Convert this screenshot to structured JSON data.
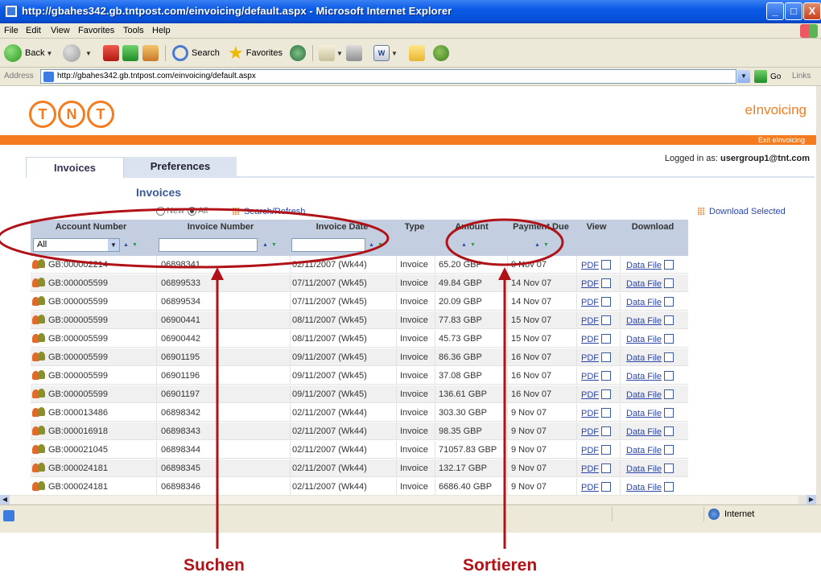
{
  "window": {
    "title": "http://gbahes342.gb.tntpost.com/einvoicing/default.aspx - Microsoft Internet Explorer",
    "controls": [
      "_",
      "□",
      "X"
    ]
  },
  "menu": [
    "File",
    "Edit",
    "View",
    "Favorites",
    "Tools",
    "Help"
  ],
  "toolbar": {
    "back": "Back",
    "search": "Search",
    "favorites": "Favorites"
  },
  "address": {
    "label": "Address",
    "url": "http://gbahes342.gb.tntpost.com/einvoicing/default.aspx",
    "go": "Go",
    "links": "Links"
  },
  "app": {
    "logo_letters": [
      "T",
      "N",
      "T"
    ],
    "title": "eInvoicing",
    "exit": "Exit eInvoicing",
    "logged_in_prefix": "Logged in as:",
    "logged_in_user": "usergroup1@tnt.com",
    "colors": {
      "brand": "#f47c1e",
      "link": "#2b46a8",
      "header_bg": "#c3cfe0",
      "annotation": "#b01218"
    }
  },
  "tabs": [
    "Invoices",
    "Preferences"
  ],
  "section": {
    "title": "Invoices",
    "radio_new": "New",
    "radio_all": "All",
    "search_refresh": "Search/Refresh",
    "download_selected": "Download Selected"
  },
  "table": {
    "columns": [
      "Account Number",
      "Invoice Number",
      "Invoice Date",
      "Type",
      "Amount",
      "Payment Due",
      "View",
      "Download"
    ],
    "account_filter": "All",
    "view_label": "PDF",
    "download_label": "Data File",
    "rows": [
      {
        "account": "GB:000002214",
        "invoice": "06898341",
        "date": "02/11/2007 (Wk44)",
        "type": "Invoice",
        "amount": "65.20 GBP",
        "due": "9 Nov 07"
      },
      {
        "account": "GB:000005599",
        "invoice": "06899533",
        "date": "07/11/2007 (Wk45)",
        "type": "Invoice",
        "amount": "49.84 GBP",
        "due": "14 Nov 07"
      },
      {
        "account": "GB:000005599",
        "invoice": "06899534",
        "date": "07/11/2007 (Wk45)",
        "type": "Invoice",
        "amount": "20.09 GBP",
        "due": "14 Nov 07"
      },
      {
        "account": "GB:000005599",
        "invoice": "06900441",
        "date": "08/11/2007 (Wk45)",
        "type": "Invoice",
        "amount": "77.83 GBP",
        "due": "15 Nov 07"
      },
      {
        "account": "GB:000005599",
        "invoice": "06900442",
        "date": "08/11/2007 (Wk45)",
        "type": "Invoice",
        "amount": "45.73 GBP",
        "due": "15 Nov 07"
      },
      {
        "account": "GB:000005599",
        "invoice": "06901195",
        "date": "09/11/2007 (Wk45)",
        "type": "Invoice",
        "amount": "86.36 GBP",
        "due": "16 Nov 07"
      },
      {
        "account": "GB:000005599",
        "invoice": "06901196",
        "date": "09/11/2007 (Wk45)",
        "type": "Invoice",
        "amount": "37.08 GBP",
        "due": "16 Nov 07"
      },
      {
        "account": "GB:000005599",
        "invoice": "06901197",
        "date": "09/11/2007 (Wk45)",
        "type": "Invoice",
        "amount": "136.61 GBP",
        "due": "16 Nov 07"
      },
      {
        "account": "GB:000013486",
        "invoice": "06898342",
        "date": "02/11/2007 (Wk44)",
        "type": "Invoice",
        "amount": "303.30 GBP",
        "due": "9 Nov 07"
      },
      {
        "account": "GB:000016918",
        "invoice": "06898343",
        "date": "02/11/2007 (Wk44)",
        "type": "Invoice",
        "amount": "98.35 GBP",
        "due": "9 Nov 07"
      },
      {
        "account": "GB:000021045",
        "invoice": "06898344",
        "date": "02/11/2007 (Wk44)",
        "type": "Invoice",
        "amount": "71057.83 GBP",
        "due": "9 Nov 07"
      },
      {
        "account": "GB:000024181",
        "invoice": "06898345",
        "date": "02/11/2007 (Wk44)",
        "type": "Invoice",
        "amount": "132.17 GBP",
        "due": "9 Nov 07"
      },
      {
        "account": "GB:000024181",
        "invoice": "06898346",
        "date": "02/11/2007 (Wk44)",
        "type": "Invoice",
        "amount": "6686.40 GBP",
        "due": "9 Nov 07"
      }
    ]
  },
  "statusbar": {
    "zone": "Internet"
  },
  "annotations": {
    "search": "Suchen",
    "sort": "Sortieren"
  }
}
